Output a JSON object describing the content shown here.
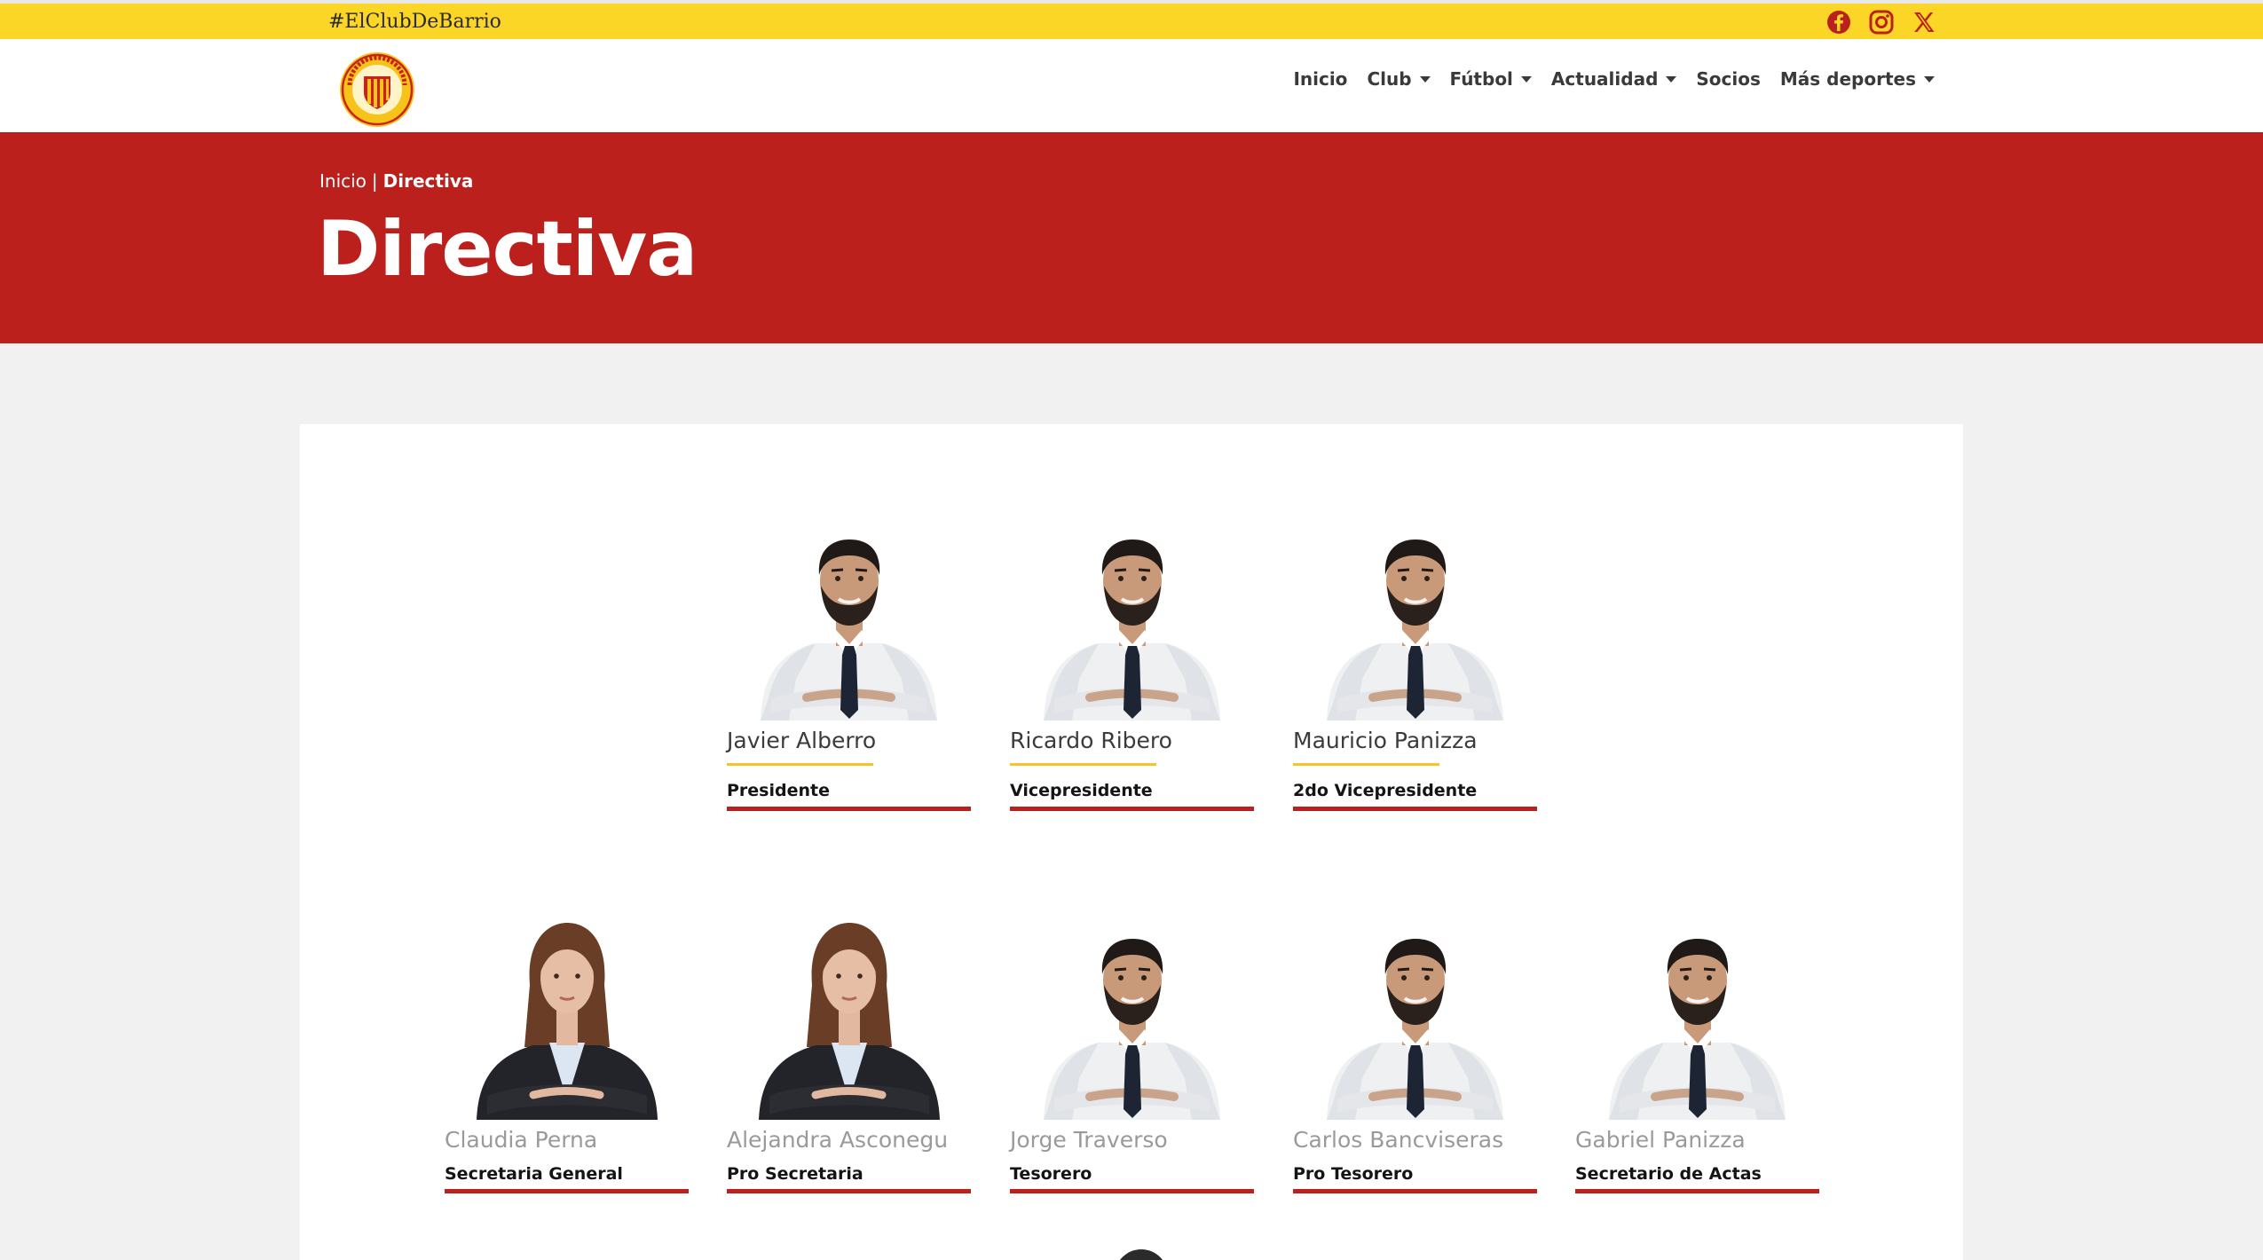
{
  "topbar": {
    "hashtag": "#ElClubDeBarrio",
    "social_icons": [
      "facebook-icon",
      "instagram-icon",
      "x-icon"
    ],
    "color": "#fcd626"
  },
  "nav": {
    "logo": "club-logo",
    "items": [
      {
        "label": "Inicio",
        "dropdown": false
      },
      {
        "label": "Club",
        "dropdown": true
      },
      {
        "label": "Fútbol",
        "dropdown": true
      },
      {
        "label": "Actualidad",
        "dropdown": true
      },
      {
        "label": "Socios",
        "dropdown": false
      },
      {
        "label": "Más deportes",
        "dropdown": true
      }
    ]
  },
  "hero": {
    "breadcrumb_home": "Inicio",
    "breadcrumb_separator": "|",
    "breadcrumb_current": "Directiva",
    "title": "Directiva",
    "color": "#bb201d"
  },
  "members": [
    {
      "name": "Javier Alberro",
      "role": "Presidente",
      "photo": "man"
    },
    {
      "name": "Ricardo Ribero",
      "role": "Vicepresidente",
      "photo": "man"
    },
    {
      "name": "Mauricio Panizza",
      "role": "2do Vicepresidente",
      "photo": "man"
    },
    {
      "name": "Claudia Perna",
      "role": "Secretaria General",
      "photo": "woman"
    },
    {
      "name": "Alejandra Asconegu",
      "role": "Pro Secretaria",
      "photo": "woman"
    },
    {
      "name": "Jorge Traverso",
      "role": "Tesorero",
      "photo": "man"
    },
    {
      "name": "Carlos Bancviseras",
      "role": "Pro Tesorero",
      "photo": "man"
    },
    {
      "name": "Gabriel Panizza",
      "role": "Secretario de Actas",
      "photo": "man"
    }
  ]
}
